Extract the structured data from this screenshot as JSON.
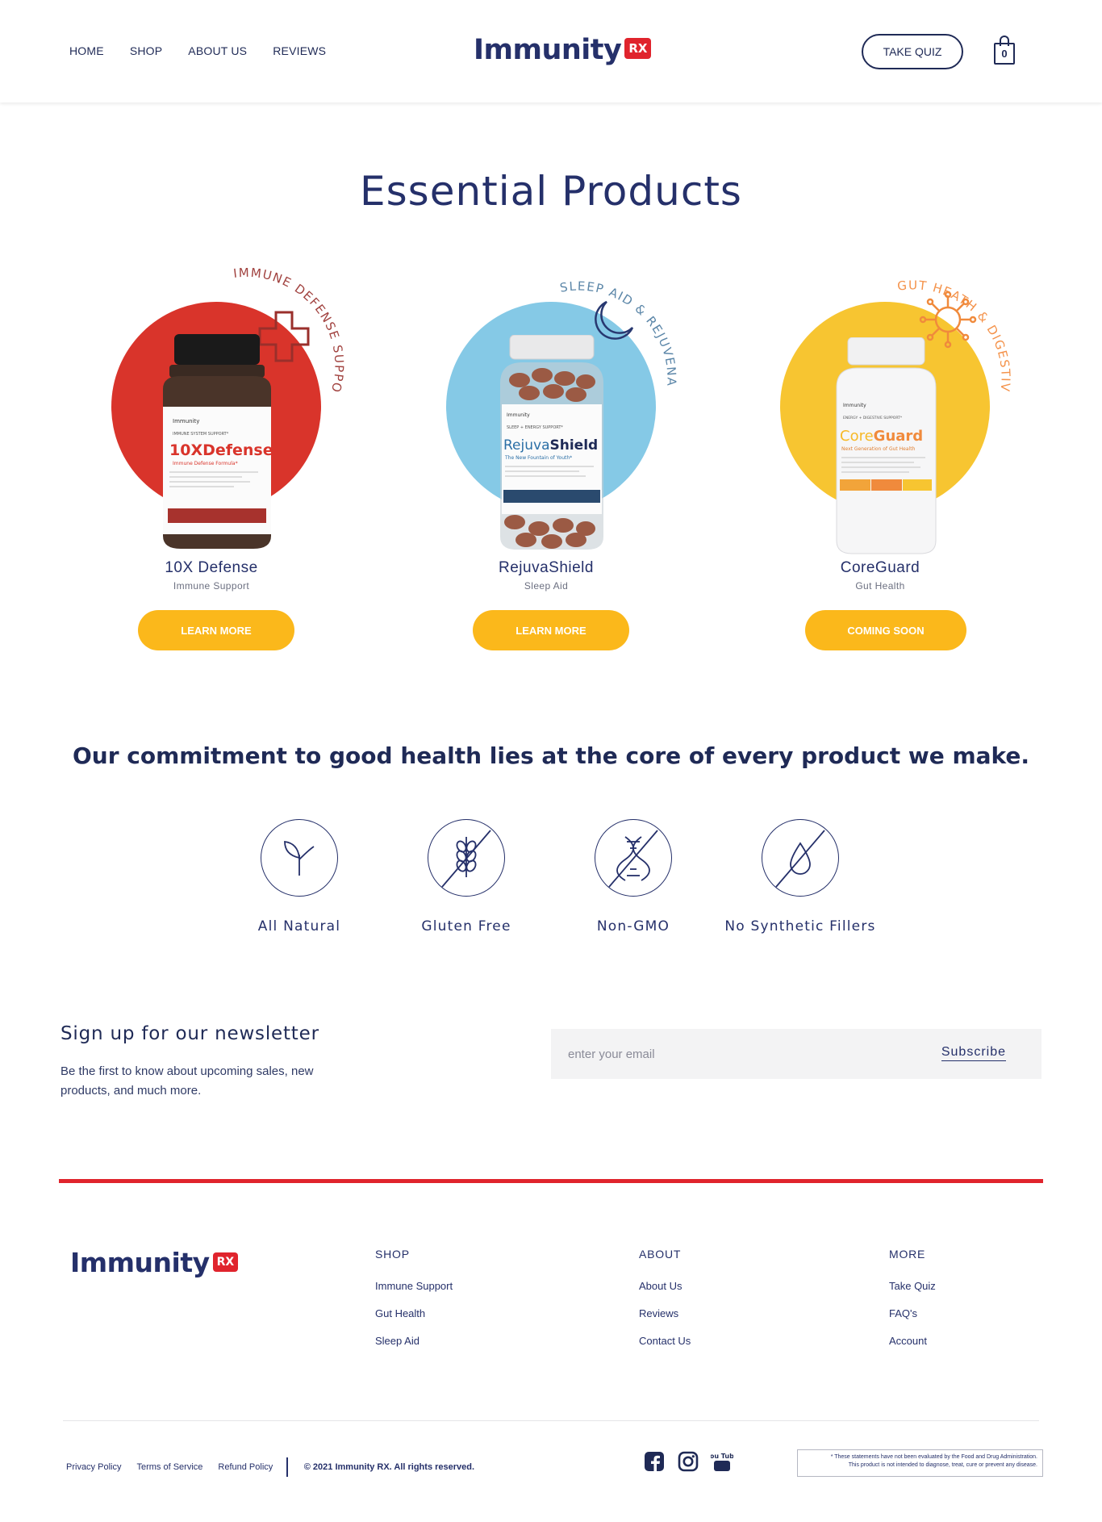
{
  "header": {
    "nav": [
      "HOME",
      "SHOP",
      "ABOUT US",
      "REVIEWS"
    ],
    "logo_text": "Immunity",
    "logo_badge": "RX",
    "quiz_label": "TAKE QUIZ",
    "cart_count": "0"
  },
  "products_section": {
    "title": "Essential Products",
    "items": [
      {
        "arc_text": "IMMUNE DEFENSE SUPPORT",
        "name": "10X Defense",
        "subtitle": "Immune Support",
        "cta": "LEARN MORE",
        "circle_color": "#d9342b",
        "arc_color": "#a1423f",
        "bottle_label": "10XDefense",
        "bottle_tagline": "Immune Defense Formula*",
        "bottle_kicker": "IMMUNE SYSTEM SUPPORT*",
        "icon": "medical-cross-icon"
      },
      {
        "arc_text": "SLEEP AID & REJUVENATION",
        "name": "RejuvaShield",
        "subtitle": "Sleep Aid",
        "cta": "LEARN MORE",
        "circle_color": "#85c9e6",
        "arc_color": "#5b86a8",
        "bottle_label_a": "Rejuva",
        "bottle_label_b": "Shield",
        "bottle_tagline": "The New Fountain of Youth*",
        "bottle_kicker": "SLEEP + ENERGY SUPPORT*",
        "icon": "moon-icon"
      },
      {
        "arc_text": "GUT HEATH & DIGESTIVE AID",
        "name": "CoreGuard",
        "subtitle": "Gut Health",
        "cta": "COMING SOON",
        "circle_color": "#f7c531",
        "arc_color": "#f4924a",
        "bottle_label_a": "Core",
        "bottle_label_b": "Guard",
        "bottle_tagline": "Next Generation of Gut Health",
        "bottle_kicker": "ENERGY + DIGESTIVE SUPPORT*",
        "icon": "bacteria-icon"
      }
    ]
  },
  "commitment": {
    "heading": "Our commitment to good health lies at the core of every product we make.",
    "badges": [
      {
        "label": "All Natural",
        "icon": "sprout-icon"
      },
      {
        "label": "Gluten Free",
        "icon": "wheat-icon"
      },
      {
        "label": "Non-GMO",
        "icon": "dna-icon"
      },
      {
        "label": "No Synthetic Fillers",
        "icon": "droplet-icon"
      }
    ]
  },
  "newsletter": {
    "title": "Sign up for our newsletter",
    "description": "Be the first to know about upcoming sales, new products, and much more.",
    "placeholder": "enter your email",
    "button": "Subscribe"
  },
  "footer": {
    "columns": [
      {
        "heading": "SHOP",
        "links": [
          "Immune Support",
          "Gut Health",
          "Sleep Aid"
        ]
      },
      {
        "heading": "ABOUT",
        "links": [
          "About Us",
          "Reviews",
          "Contact Us"
        ]
      },
      {
        "heading": "MORE",
        "links": [
          "Take Quiz",
          "FAQ's",
          "Account"
        ]
      }
    ],
    "legal_links": [
      "Privacy Policy",
      "Terms of Service",
      "Refund Policy"
    ],
    "copyright": "© 2021 Immunity RX. All rights reserved.",
    "social": [
      "facebook-icon",
      "instagram-icon",
      "youtube-icon"
    ],
    "youtube_text": "You Tube",
    "disclaimer_line1": "* These statements have not been evaluated by the Food and Drug Administration.",
    "disclaimer_line2": "This product is not intended to diagnose, treat, cure or prevent any disease."
  },
  "colors": {
    "navy": "#1f2a56",
    "brand_red": "#e0242d",
    "cta_yellow": "#fbb81b"
  }
}
